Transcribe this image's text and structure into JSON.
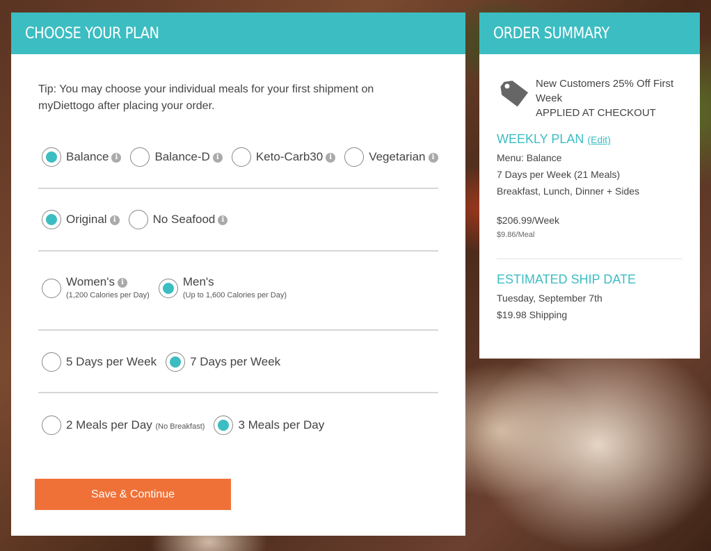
{
  "plan": {
    "header": "CHOOSE YOUR PLAN",
    "tip": "Tip: You may choose your individual meals for your first shipment on myDiettogo after placing your order.",
    "menus": [
      {
        "label": "Balance",
        "selected": true,
        "info": true
      },
      {
        "label": "Balance-D",
        "selected": false,
        "info": true
      },
      {
        "label": "Keto-Carb30",
        "selected": false,
        "info": true
      },
      {
        "label": "Vegetarian",
        "selected": false,
        "info": true
      }
    ],
    "diet": [
      {
        "label": "Original",
        "selected": true,
        "info": true
      },
      {
        "label": "No Seafood",
        "selected": false,
        "info": true
      }
    ],
    "gender": [
      {
        "label": "Women's",
        "sub": "(1,200 Calories per Day)",
        "selected": false,
        "info": true
      },
      {
        "label": "Men's",
        "sub": "(Up to 1,600 Calories per Day)",
        "selected": true,
        "info": false
      }
    ],
    "days": [
      {
        "label": "5 Days per Week",
        "selected": false
      },
      {
        "label": "7 Days per Week",
        "selected": true
      }
    ],
    "meals": [
      {
        "label": "2 Meals per Day",
        "small": "(No Breakfast)",
        "selected": false
      },
      {
        "label": "3 Meals per Day",
        "small": "",
        "selected": true
      }
    ],
    "save_label": "Save & Continue"
  },
  "summary": {
    "header": "ORDER SUMMARY",
    "promo_line1": "New Customers 25% Off First Week",
    "promo_line2": "APPLIED AT CHECKOUT",
    "weekly_title": "WEEKLY PLAN",
    "edit_label": "(Edit)",
    "menu": "Menu: Balance",
    "days": "7 Days per Week (21 Meals)",
    "meals": "Breakfast, Lunch, Dinner + Sides",
    "price": "$206.99/Week",
    "per_meal": "$9.86/Meal",
    "ship_title": "ESTIMATED SHIP DATE",
    "ship_date": "Tuesday, September 7th",
    "shipping": "$19.98 Shipping"
  },
  "colors": {
    "accent": "#3cbdc2",
    "button": "#f07138"
  },
  "icons": {
    "info": "info-icon",
    "tag": "price-tag-icon"
  }
}
